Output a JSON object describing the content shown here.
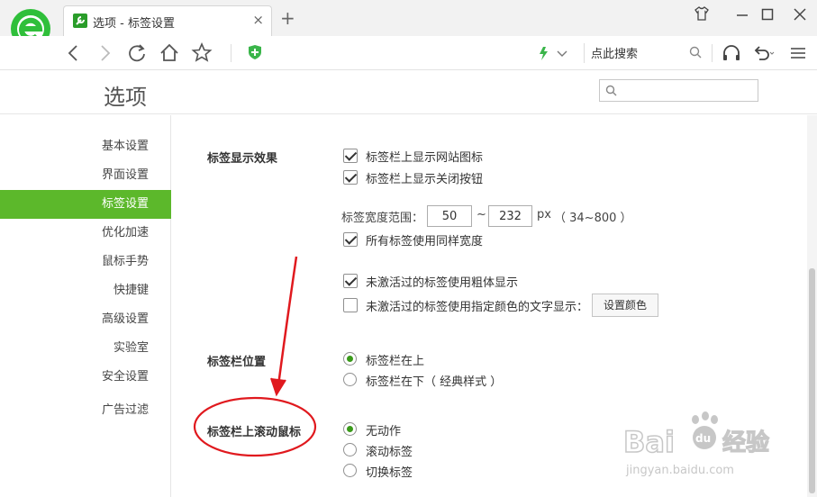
{
  "browser": {
    "tab": {
      "title": "选项 - 标签设置",
      "close": "×"
    },
    "new_tab": "+",
    "search_hint": "点此搜索"
  },
  "options": {
    "title": "选项",
    "search": {
      "value": "",
      "placeholder": ""
    }
  },
  "sidebar": {
    "items": [
      {
        "label": "基本设置"
      },
      {
        "label": "界面设置"
      },
      {
        "label": "标签设置",
        "active": true
      },
      {
        "label": "优化加速"
      },
      {
        "label": "鼠标手势"
      },
      {
        "label": "快捷键"
      },
      {
        "label": "高级设置"
      },
      {
        "label": "实验室"
      },
      {
        "label": "安全设置"
      },
      {
        "label": "广告过滤"
      }
    ]
  },
  "tab_display": {
    "label": "标签显示效果",
    "show_site_icon": {
      "label": "标签栏上显示网站图标",
      "checked": true
    },
    "show_close_button": {
      "label": "标签栏上显示关闭按钮",
      "checked": true
    },
    "width_range": {
      "label": "标签宽度范围：",
      "min": "50",
      "tilde": "~",
      "max": "232",
      "unit": "px",
      "hint": "（ 34~800 ）"
    },
    "same_width": {
      "label": "所有标签使用同样宽度",
      "checked": true
    },
    "bold_inactive": {
      "label": "未激活过的标签使用粗体显示",
      "checked": true
    },
    "color_inactive": {
      "label": "未激活过的标签使用指定颜色的文字显示：",
      "checked": false
    },
    "set_color_button": "设置颜色"
  },
  "tab_position": {
    "label": "标签栏位置",
    "options": [
      {
        "label": "标签栏在上",
        "checked": true
      },
      {
        "label": "标签栏在下（ 经典样式 ）",
        "checked": false
      }
    ]
  },
  "tab_scroll": {
    "label": "标签栏上滚动鼠标",
    "options": [
      {
        "label": "无动作",
        "checked": true
      },
      {
        "label": "滚动标签",
        "checked": false
      },
      {
        "label": "切换标签",
        "checked": false
      }
    ]
  },
  "colors": {
    "accent": "#5cb82b",
    "annotation": "#e0191e",
    "logo": "#2fbf3a"
  },
  "watermark": {
    "brand": "Bai",
    "paw": "du",
    "cn": "经验",
    "url": "jingyan.baidu.com"
  }
}
